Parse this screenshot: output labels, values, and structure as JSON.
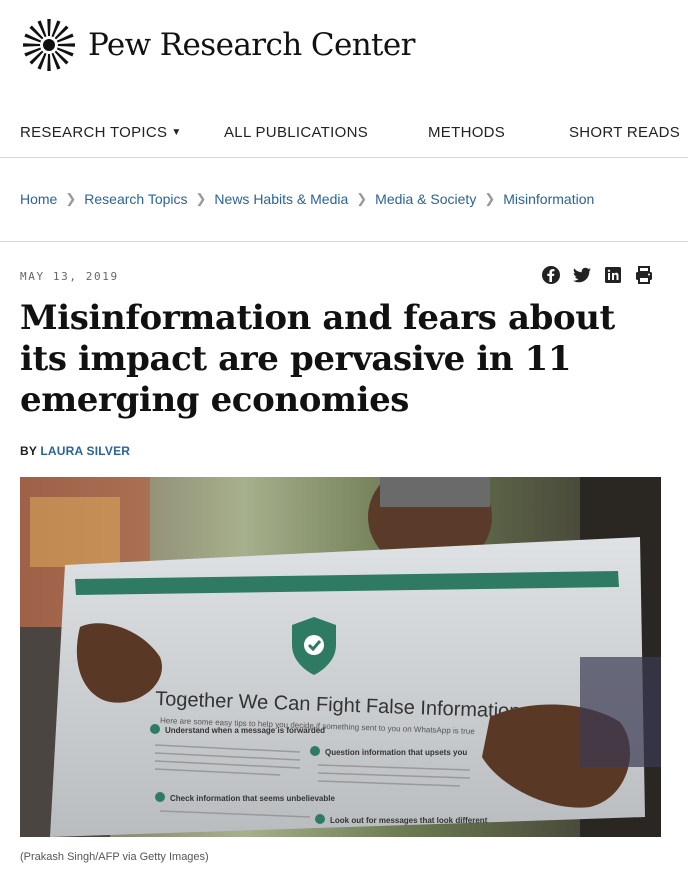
{
  "site": {
    "name": "Pew Research Center"
  },
  "nav": {
    "items": [
      "RESEARCH TOPICS",
      "ALL PUBLICATIONS",
      "METHODS",
      "SHORT READS"
    ]
  },
  "breadcrumb": [
    "Home",
    "Research Topics",
    "News Habits & Media",
    "Media & Society",
    "Misinformation"
  ],
  "article": {
    "date": "MAY 13, 2019",
    "title": "Misinformation and fears about its impact are pervasive in 11 emerging economies",
    "byline_prefix": "BY",
    "author": "LAURA SILVER"
  },
  "share_icons": [
    "facebook-icon",
    "twitter-icon",
    "linkedin-icon",
    "print-icon"
  ],
  "photo": {
    "headline": "Together We Can Fight False Information",
    "subline": "Here are some easy tips to help you decide if something sent to you on WhatsApp is true",
    "tip1": "Understand when a message is forwarded",
    "tip2": "Question information that upsets you",
    "tip3": "Check information that seems unbelievable",
    "tip4": "Look out for messages that look different",
    "caption": "(Prakash Singh/AFP via Getty Images)"
  },
  "colors": {
    "link": "#2a6496",
    "text": "#111111",
    "rule": "#d6d6d6"
  }
}
